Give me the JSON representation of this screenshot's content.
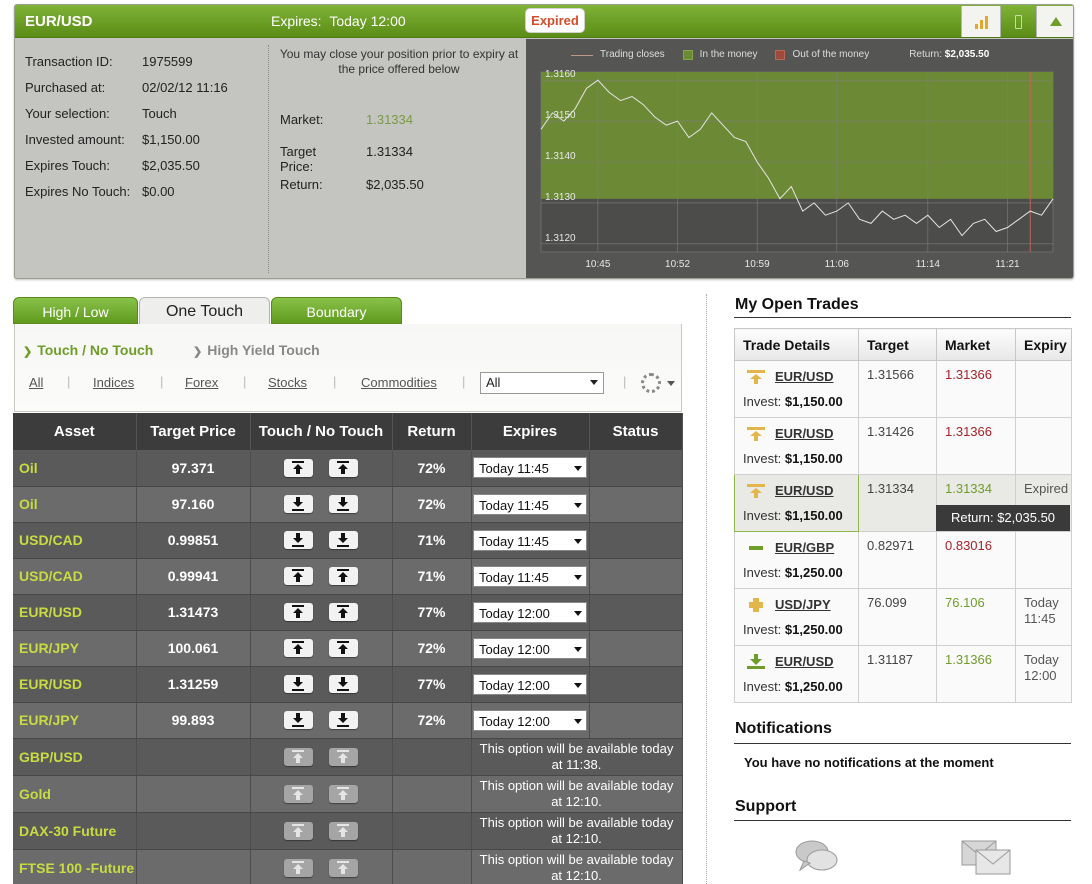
{
  "summary": {
    "asset": "EUR/USD",
    "expires_label": "Expires:",
    "expires_value": "Today 12:00",
    "status_badge": "Expired",
    "details": [
      {
        "label": "Transaction ID:",
        "value": "1975599"
      },
      {
        "label": "Purchased at:",
        "value": "02/02/12 11:16"
      },
      {
        "label": "Your selection:",
        "value": "Touch"
      },
      {
        "label": "Invested amount:",
        "value": "$1,150.00"
      },
      {
        "label": "Expires Touch:",
        "value": "$2,035.50"
      },
      {
        "label": "Expires No Touch:",
        "value": "$0.00"
      }
    ],
    "close_note": "You may close your position prior to expiry at the price offered below",
    "market_label": "Market:",
    "market_value": "1.31334",
    "target_label": "Target Price:",
    "target_value": "1.31334",
    "return_label": "Return:",
    "return_value": "$2,035.50"
  },
  "chart_data": {
    "type": "line",
    "legend": [
      "Trading closes",
      "In the money",
      "Out of the money"
    ],
    "legend_return_label": "Return:",
    "legend_return_value": "$2,035.50",
    "x_ticks": [
      "10:45",
      "10:52",
      "10:59",
      "11:06",
      "11:14",
      "11:21"
    ],
    "y_ticks": [
      "1.3120",
      "1.3130",
      "1.3140",
      "1.3150",
      "1.3160"
    ],
    "ylim": [
      1.3118,
      1.3162
    ],
    "in_the_money_range": [
      1.3131,
      1.3162
    ],
    "trading_close_time": "11:23",
    "series": [
      {
        "x": [
          "10:40",
          "10:41",
          "10:42",
          "10:43",
          "10:44",
          "10:45",
          "10:46",
          "10:47",
          "10:48",
          "10:49",
          "10:50",
          "10:51",
          "10:52",
          "10:53",
          "10:54",
          "10:55",
          "10:56",
          "10:57",
          "10:58",
          "10:59",
          "11:00",
          "11:01",
          "11:02",
          "11:03",
          "11:04",
          "11:05",
          "11:06",
          "11:07",
          "11:08",
          "11:09",
          "11:10",
          "11:11",
          "11:12",
          "11:13",
          "11:14",
          "11:15",
          "11:16",
          "11:17",
          "11:18",
          "11:19",
          "11:20",
          "11:21",
          "11:22",
          "11:23",
          "11:24",
          "11:25"
        ],
        "values": [
          1.3148,
          1.3152,
          1.315,
          1.3153,
          1.3158,
          1.316,
          1.3157,
          1.3155,
          1.3156,
          1.3154,
          1.3151,
          1.3149,
          1.315,
          1.3146,
          1.3148,
          1.3152,
          1.3149,
          1.3146,
          1.3145,
          1.314,
          1.3136,
          1.3131,
          1.3134,
          1.3128,
          1.313,
          1.3127,
          1.3128,
          1.313,
          1.3126,
          1.3125,
          1.3128,
          1.3126,
          1.3127,
          1.3125,
          1.3127,
          1.3124,
          1.3126,
          1.3122,
          1.3125,
          1.3126,
          1.3123,
          1.3124,
          1.3126,
          1.3128,
          1.3127,
          1.3131
        ]
      }
    ]
  },
  "product_tabs": [
    "High / Low",
    "One Touch",
    "Boundary"
  ],
  "sub_tabs": [
    "Touch / No Touch",
    "High Yield Touch"
  ],
  "filters": [
    "All",
    "Indices",
    "Forex",
    "Stocks",
    "Commodities"
  ],
  "category_select": "All",
  "table": {
    "headers": [
      "Asset",
      "Target Price",
      "Touch / No Touch",
      "Return",
      "Expires",
      "Status"
    ],
    "rows": [
      {
        "asset": "Oil",
        "target": "97.371",
        "dir": "up",
        "return": "72%",
        "expires": "Today 11:45"
      },
      {
        "asset": "Oil",
        "target": "97.160",
        "dir": "down",
        "return": "72%",
        "expires": "Today 11:45"
      },
      {
        "asset": "USD/CAD",
        "target": "0.99851",
        "dir": "down",
        "return": "71%",
        "expires": "Today 11:45"
      },
      {
        "asset": "USD/CAD",
        "target": "0.99941",
        "dir": "up",
        "return": "71%",
        "expires": "Today 11:45"
      },
      {
        "asset": "EUR/USD",
        "target": "1.31473",
        "dir": "up",
        "return": "77%",
        "expires": "Today 12:00"
      },
      {
        "asset": "EUR/JPY",
        "target": "100.061",
        "dir": "up",
        "return": "72%",
        "expires": "Today 12:00"
      },
      {
        "asset": "EUR/USD",
        "target": "1.31259",
        "dir": "down",
        "return": "77%",
        "expires": "Today 12:00"
      },
      {
        "asset": "EUR/JPY",
        "target": "99.893",
        "dir": "down",
        "return": "72%",
        "expires": "Today 12:00"
      },
      {
        "asset": "GBP/USD",
        "note": "This option will be available today at 11:38."
      },
      {
        "asset": "Gold",
        "note": "This option will be available today at 12:10."
      },
      {
        "asset": "DAX-30 Future",
        "note": "This option will be available today at 12:10."
      },
      {
        "asset": "FTSE 100 -Future",
        "note": "This option will be available today at 12:10."
      }
    ]
  },
  "open_trades": {
    "title": "My Open Trades",
    "headers": [
      "Trade Details",
      "Target",
      "Market",
      "Expiry"
    ],
    "invest_label": "Invest:",
    "rows": [
      {
        "icon": "touch-up-icon",
        "asset": "EUR/USD",
        "invest": "$1,150.00",
        "target": "1.31566",
        "market": "1.31366",
        "market_color": "red",
        "expiry": ""
      },
      {
        "icon": "touch-up-icon",
        "asset": "EUR/USD",
        "invest": "$1,150.00",
        "target": "1.31426",
        "market": "1.31366",
        "market_color": "red",
        "expiry": ""
      },
      {
        "icon": "touch-up-icon",
        "asset": "EUR/USD",
        "invest": "$1,150.00",
        "target": "1.31334",
        "market": "1.31334",
        "market_color": "green",
        "expiry": "Expired"
      },
      {
        "icon": "minus-icon",
        "asset": "EUR/GBP",
        "invest": "$1,250.00",
        "target": "0.82971",
        "market": "0.83016",
        "market_color": "red",
        "expiry": ""
      },
      {
        "icon": "plus-icon",
        "asset": "USD/JPY",
        "invest": "$1,250.00",
        "target": "76.099",
        "market": "76.106",
        "market_color": "green",
        "expiry": "Today 11:45"
      },
      {
        "icon": "touch-down-icon",
        "asset": "EUR/USD",
        "invest": "$1,250.00",
        "target": "1.31187",
        "market": "1.31366",
        "market_color": "green",
        "expiry": "Today 12:00"
      }
    ],
    "return_popup": "Return: $2,035.50"
  },
  "notifications": {
    "title": "Notifications",
    "text": "You have no notifications at the moment"
  },
  "support": {
    "title": "Support"
  },
  "colors": {
    "brand_green": "#6f9d2a",
    "asset_yellow": "#c8dc42",
    "loss_red": "#a5232a",
    "expired_orange": "#d24e2a"
  }
}
